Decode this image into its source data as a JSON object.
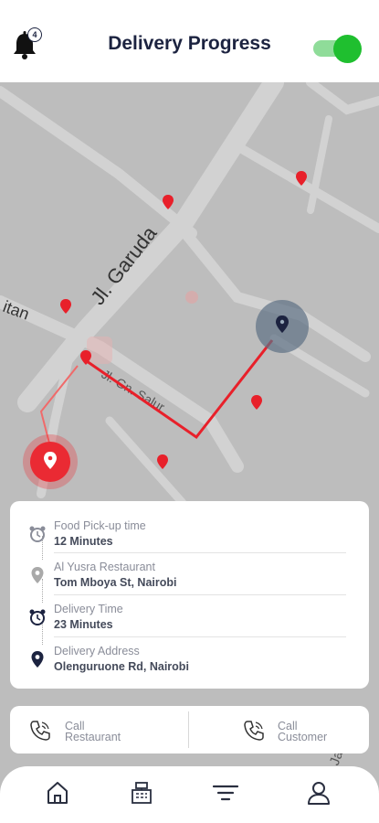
{
  "header": {
    "title": "Delivery Progress",
    "notification_count": "4",
    "toggle_on": true
  },
  "map": {
    "street_labels": [
      "Jl. Garuda",
      "Jl. Gn. Salur",
      "itan",
      "Jay"
    ]
  },
  "details": [
    {
      "label": "Food Pick-up time",
      "value": "12 Minutes",
      "icon": "alarm-clock-icon"
    },
    {
      "label": "Al Yusra Restaurant",
      "value": "Tom Mboya St, Nairobi",
      "icon": "location-pin-icon"
    },
    {
      "label": "Delivery Time",
      "value": "23 Minutes",
      "icon": "alarm-clock-icon"
    },
    {
      "label": "Delivery Address",
      "value": "Olenguruone Rd, Nairobi",
      "icon": "location-pin-icon"
    }
  ],
  "actions": {
    "call_restaurant": [
      "Call",
      "Restaurant"
    ],
    "call_customer": [
      "Call",
      "Customer"
    ]
  },
  "nav": [
    "home-icon",
    "cash-register-icon",
    "filter-icon",
    "profile-icon"
  ],
  "colors": {
    "accent": "#e8202a",
    "navy": "#1c2340",
    "toggle": "#1fbf2f",
    "map_bg": "#bdbdbd",
    "road": "#d2d2d2"
  }
}
